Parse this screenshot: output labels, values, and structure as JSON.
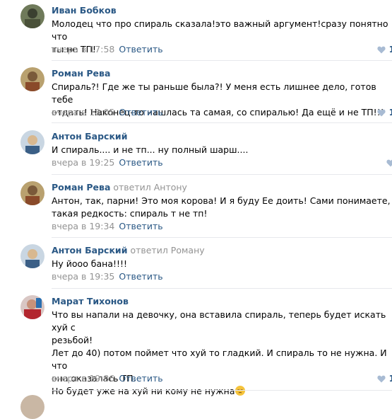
{
  "reply_label": "Ответить",
  "comments": [
    {
      "author": "Иван Бобков",
      "replied_to": "",
      "text": "Молодец что про спираль сказала!это важный аргумент!сразу понятно что\nты не ТП!",
      "time": "вчера в 17:58",
      "likes": "1"
    },
    {
      "author": "Роман Рева",
      "replied_to": "",
      "text": "Спираль?! Где же ты раньше была?! У меня есть лишнее дело, готов тебе\nотдать! Наконец-то нашлась та самая, со спиралью! Да ещё и не ТП!!!",
      "time": "вчера в 18:05",
      "likes": "1"
    },
    {
      "author": "Антон Барский",
      "replied_to": "",
      "text": "И спираль.... и не тп... ну полный шарш....",
      "time": "вчера в 19:25",
      "likes": ""
    },
    {
      "author": "Роман Рева",
      "replied_to": "ответил Антону",
      "text": "Антон, так, парни! Это моя корова! И я буду Ее доить! Сами понимаете,\nтакая редкость: спираль т не тп!",
      "time": "вчера в 19:34",
      "likes": ""
    },
    {
      "author": "Антон Барский",
      "replied_to": "ответил Роману",
      "text": "Ну йооо бана!!!!",
      "time": "вчера в 19:35",
      "likes": ""
    },
    {
      "author": "Марат Тихонов",
      "replied_to": "",
      "text": "Что вы напали на девочку, она вставила спираль, теперь будет искать хуй с\nрезьбой!\nЛет до 40) потом поймет что хуй то гладкий. И спираль то не нужна. И что\nона оказалась ТП.\nНо будет уже на хуй ни кому не нужна",
      "time": "вчера в 19:36",
      "likes": "1",
      "emoji": "pensive-face-emoji"
    }
  ],
  "colors": {
    "author_link": "#2a5885",
    "meta_gray": "#939393",
    "divider": "#e7e8ec",
    "heart": "#a8bbd3"
  }
}
